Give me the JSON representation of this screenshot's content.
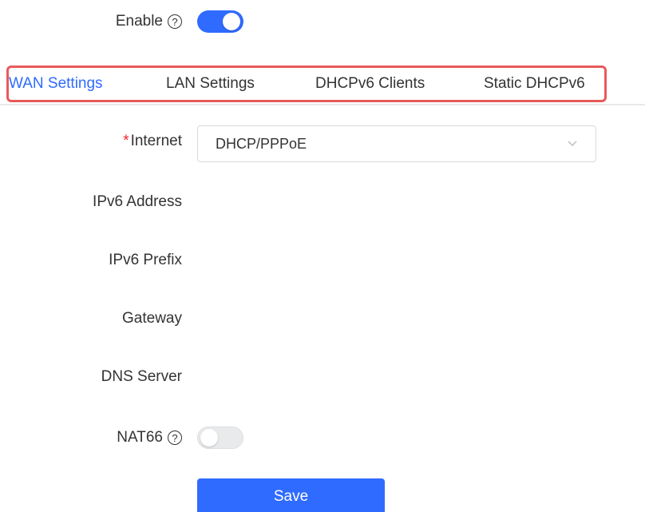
{
  "enable": {
    "label": "Enable",
    "help_icon": "question-circle",
    "state": "on"
  },
  "tabs": [
    {
      "label": "WAN Settings",
      "active": true
    },
    {
      "label": "LAN Settings",
      "active": false
    },
    {
      "label": "DHCPv6 Clients",
      "active": false
    },
    {
      "label": "Static DHCPv6",
      "active": false
    }
  ],
  "form": {
    "internet": {
      "required_mark": "*",
      "label": "Internet",
      "value": "DHCP/PPPoE"
    },
    "ipv6_address": {
      "label": "IPv6 Address",
      "value": ""
    },
    "ipv6_prefix": {
      "label": "IPv6 Prefix",
      "value": ""
    },
    "gateway": {
      "label": "Gateway",
      "value": ""
    },
    "dns_server": {
      "label": "DNS Server",
      "value": ""
    },
    "nat66": {
      "label": "NAT66",
      "help_icon": "question-circle",
      "state": "off"
    }
  },
  "save_label": "Save",
  "colors": {
    "accent": "#2f6bff",
    "highlight_border": "#e85a5a",
    "required": "#f5222d"
  }
}
